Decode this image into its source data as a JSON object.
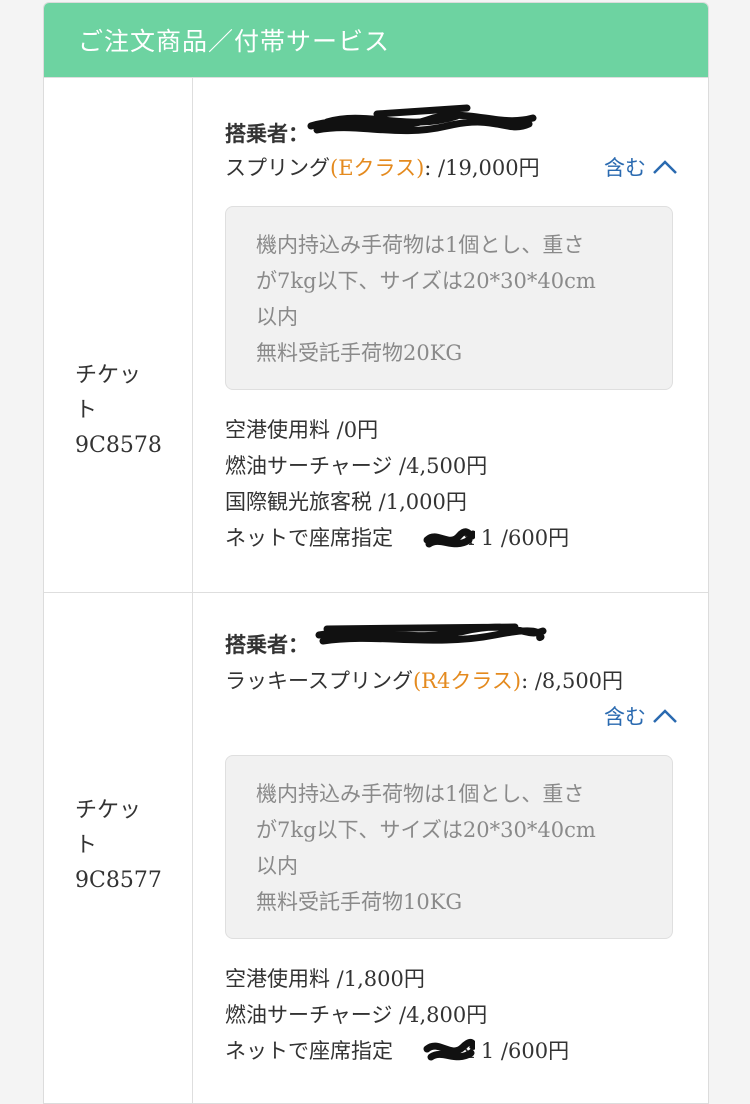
{
  "section_title": "ご注文商品／付帯サービス",
  "tickets": [
    {
      "ticket_label_1": "チケッ",
      "ticket_label_2": "ト",
      "ticket_number": "9C8578",
      "passenger_label": "搭乗者：",
      "fare_name": "スプリング",
      "fare_class": "(Eクラス)",
      "fare_price": ": /19,000円",
      "toggle_label": "含む",
      "toggle_icon": "chevron-up-icon",
      "baggage_lines": [
        "機内持込み手荷物は1個とし、重さ",
        "が7kg以下、サイズは20*30*40cm",
        "以内",
        "無料受託手荷物20KG"
      ],
      "fees": [
        "空港使用料 /0円",
        "燃油サーチャージ /4,500円",
        "国際観光旅客税 /1,000円"
      ],
      "seat_label": "ネットで座席指定",
      "seat_suffix": "x 1 /600円"
    },
    {
      "ticket_label_1": "チケッ",
      "ticket_label_2": "ト",
      "ticket_number": "9C8577",
      "passenger_label": "搭乗者：",
      "fare_name": "ラッキースプリング",
      "fare_class": "(R4クラス)",
      "fare_price": ": /8,500円",
      "toggle_label": "含む",
      "toggle_icon": "chevron-up-icon",
      "baggage_lines": [
        "機内持込み手荷物は1個とし、重さ",
        "が7kg以下、サイズは20*30*40cm",
        "以内",
        "無料受託手荷物10KG"
      ],
      "fees": [
        "空港使用料 /1,800円",
        "燃油サーチャージ /4,800円"
      ],
      "seat_label": "ネットで座席指定",
      "seat_suffix": "x 1 /600円"
    }
  ],
  "colors": {
    "header_bg": "#6dd3a1",
    "fare_class": "#e48a1e",
    "toggle": "#2a6ab0"
  }
}
